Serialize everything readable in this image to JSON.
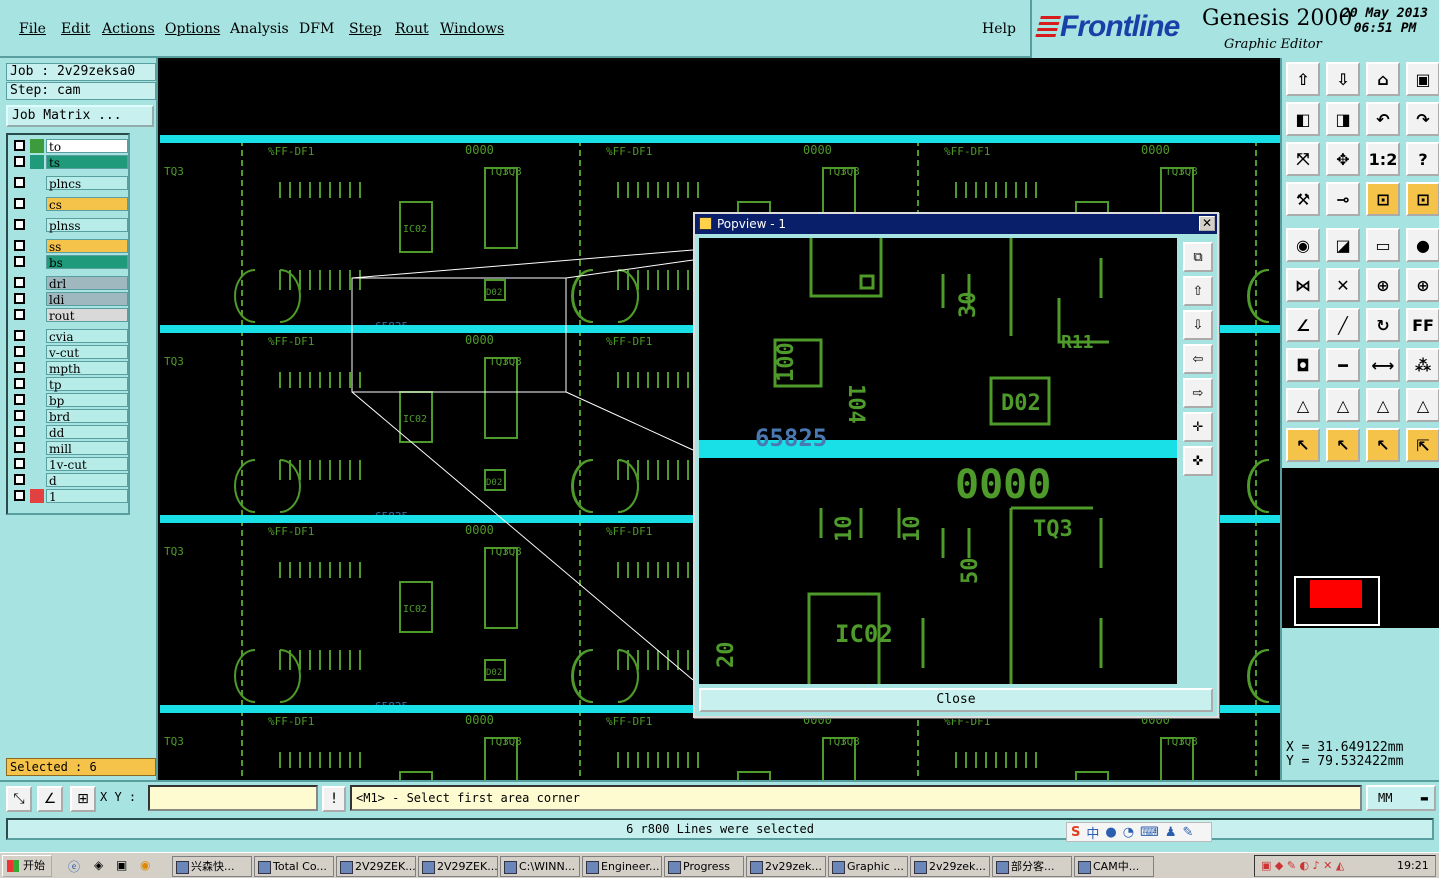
{
  "menu": {
    "items": [
      "File",
      "Edit",
      "Actions",
      "Options",
      "Analysis",
      "DFM",
      "Step",
      "Rout",
      "Windows"
    ],
    "help": "Help"
  },
  "brand": {
    "logo": "Frontline",
    "product": "Genesis 2000",
    "subtitle": "Graphic Editor",
    "date": "20 May 2013",
    "time": "06:51 PM"
  },
  "job": {
    "job_label": "Job : 2v29zeksa0",
    "step_label": "Step: cam",
    "matrix_button": "Job Matrix ..."
  },
  "layers": [
    {
      "name": "to",
      "color": "#ffffff",
      "swatch": "#3d9a3d"
    },
    {
      "name": "ts",
      "color": "#1f9a7a",
      "swatch": "#1f9a7a"
    },
    {
      "name": "plncs",
      "color": "#b8ece9",
      "swatch": "#a6e3e1"
    },
    {
      "name": "cs",
      "color": "#f5c24a",
      "swatch": "#a6e3e1"
    },
    {
      "name": "plnss",
      "color": "#b8ece9",
      "swatch": "#a6e3e1"
    },
    {
      "name": "ss",
      "color": "#f5c24a",
      "swatch": "#a6e3e1"
    },
    {
      "name": "bs",
      "color": "#1f9a7a",
      "swatch": "#a6e3e1"
    },
    {
      "name": "drl",
      "color": "#9fb8bf",
      "swatch": "#a6e3e1"
    },
    {
      "name": "ldi",
      "color": "#9fb8bf",
      "swatch": "#a6e3e1"
    },
    {
      "name": "rout",
      "color": "#d9d9d9",
      "swatch": "#a6e3e1"
    },
    {
      "name": "cvia",
      "color": "#b8ece9",
      "swatch": "#a6e3e1"
    },
    {
      "name": "v-cut",
      "color": "#b8ece9",
      "swatch": "#a6e3e1"
    },
    {
      "name": "mpth",
      "color": "#b8ece9",
      "swatch": "#a6e3e1"
    },
    {
      "name": "tp",
      "color": "#b8ece9",
      "swatch": "#a6e3e1"
    },
    {
      "name": "bp",
      "color": "#b8ece9",
      "swatch": "#a6e3e1"
    },
    {
      "name": "brd",
      "color": "#b8ece9",
      "swatch": "#a6e3e1"
    },
    {
      "name": "dd",
      "color": "#b8ece9",
      "swatch": "#a6e3e1"
    },
    {
      "name": "mill",
      "color": "#b8ece9",
      "swatch": "#a6e3e1"
    },
    {
      "name": "1v-cut",
      "color": "#b8ece9",
      "swatch": "#a6e3e1"
    },
    {
      "name": "d",
      "color": "#b8ece9",
      "swatch": "#a6e3e1"
    },
    {
      "name": "1",
      "color": "#b8ece9",
      "swatch": "#e34040"
    }
  ],
  "selected_label": "Selected : 6",
  "coords": {
    "x": "X  =  31.649122mm",
    "y": "Y  =  79.532422mm"
  },
  "input": {
    "xy_label": "X Y :",
    "prompt": "<M1> - Select first area corner",
    "units": "MM"
  },
  "status_message": "6 r800 Lines were selected",
  "popview": {
    "title": "Popview - 1",
    "close_label": "Close",
    "texts": {
      "ic": "IC02",
      "serial": "65825",
      "tq": "TQ3",
      "r": "R11",
      "d": "D02",
      "counter": "0000",
      "c100": "100",
      "c104": "104",
      "c30": "30",
      "c10": "10",
      "c50": "50",
      "c20": "20"
    }
  },
  "board": {
    "tq": "TQ3",
    "ic": "IC02",
    "serial": "65825",
    "dff": "FF-DF1",
    "counter": "0000",
    "d": "D02"
  },
  "taskbar": {
    "start": "开始",
    "tasks": [
      "兴森快...",
      "Total Co...",
      "2V29ZEK...",
      "2V29ZEK...",
      "C:\\WINN...",
      "Engineer...",
      "Progress",
      "2v29zek...",
      "Graphic ...",
      "2v29zek...",
      "部分客...",
      "CAM中..."
    ],
    "clock": "19:21"
  },
  "colors": {
    "panel": "#a6e3e1",
    "trace": "#4e9a2a",
    "rail": "#19e0e6",
    "highlight": "#f5c24a"
  }
}
